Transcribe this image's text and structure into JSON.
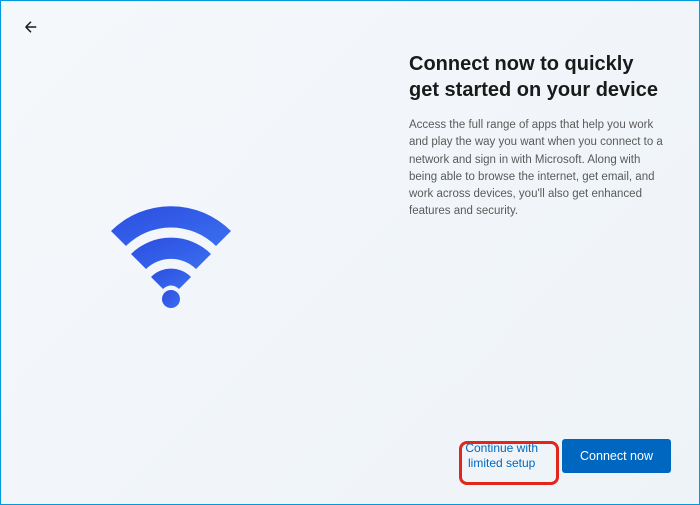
{
  "header": {
    "back_icon": "back-arrow"
  },
  "main": {
    "title": "Connect now to quickly get started on your device",
    "description": "Access the full range of apps that help you work and play the way you want when you connect to a network and sign in with Microsoft. Along with being able to browse the internet, get email, and work across devices, you'll also get enhanced features and security."
  },
  "illustration": {
    "name": "wifi-icon",
    "colors": {
      "start": "#2b4de0",
      "end": "#3b6ff0"
    }
  },
  "footer": {
    "secondary_label_line1": "Continue with",
    "secondary_label_line2": "limited setup",
    "primary_label": "Connect now"
  },
  "annotation": {
    "highlight_color": "#e1261c"
  }
}
